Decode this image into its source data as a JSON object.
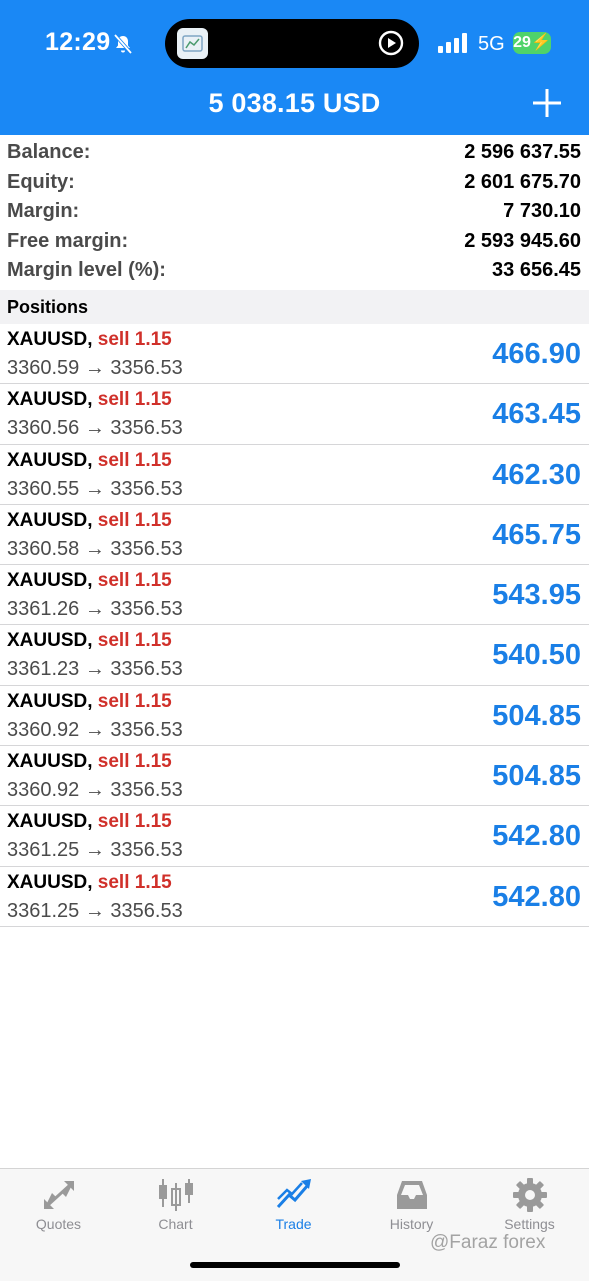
{
  "status_bar": {
    "time": "12:29",
    "network": "5G",
    "battery": "29"
  },
  "header": {
    "equity_title": "5 038.15 USD"
  },
  "summary": [
    {
      "label": "Balance:",
      "value": "2 596 637.55"
    },
    {
      "label": "Equity:",
      "value": "2 601 675.70"
    },
    {
      "label": "Margin:",
      "value": "7 730.10"
    },
    {
      "label": "Free margin:",
      "value": "2 593 945.60"
    },
    {
      "label": "Margin level (%):",
      "value": "33 656.45"
    }
  ],
  "positions_title": "Positions",
  "positions": [
    {
      "symbol": "XAUUSD,",
      "type": "sell 1.15",
      "prices": "3360.59 → 3356.53",
      "profit": "466.90"
    },
    {
      "symbol": "XAUUSD,",
      "type": "sell 1.15",
      "prices": "3360.56 → 3356.53",
      "profit": "463.45"
    },
    {
      "symbol": "XAUUSD,",
      "type": "sell 1.15",
      "prices": "3360.55 → 3356.53",
      "profit": "462.30"
    },
    {
      "symbol": "XAUUSD,",
      "type": "sell 1.15",
      "prices": "3360.58 → 3356.53",
      "profit": "465.75"
    },
    {
      "symbol": "XAUUSD,",
      "type": "sell 1.15",
      "prices": "3361.26 → 3356.53",
      "profit": "543.95"
    },
    {
      "symbol": "XAUUSD,",
      "type": "sell 1.15",
      "prices": "3361.23 → 3356.53",
      "profit": "540.50"
    },
    {
      "symbol": "XAUUSD,",
      "type": "sell 1.15",
      "prices": "3360.92 → 3356.53",
      "profit": "504.85"
    },
    {
      "symbol": "XAUUSD,",
      "type": "sell 1.15",
      "prices": "3360.92 → 3356.53",
      "profit": "504.85"
    },
    {
      "symbol": "XAUUSD,",
      "type": "sell 1.15",
      "prices": "3361.25 → 3356.53",
      "profit": "542.80"
    },
    {
      "symbol": "XAUUSD,",
      "type": "sell 1.15",
      "prices": "3361.25 → 3356.53",
      "profit": "542.80"
    }
  ],
  "tabs": [
    {
      "label": "Quotes",
      "icon": "quotes-icon",
      "active": false
    },
    {
      "label": "Chart",
      "icon": "chart-icon",
      "active": false
    },
    {
      "label": "Trade",
      "icon": "trade-icon",
      "active": true
    },
    {
      "label": "History",
      "icon": "history-icon",
      "active": false
    },
    {
      "label": "Settings",
      "icon": "gear-icon",
      "active": false
    }
  ],
  "watermark": "@Faraz forex",
  "colors": {
    "header_bg": "#1a88f5",
    "sell": "#d0302a",
    "profit": "#1a7fe6",
    "active_tab": "#1a7fe6",
    "inactive_tab": "#8e8e93"
  }
}
